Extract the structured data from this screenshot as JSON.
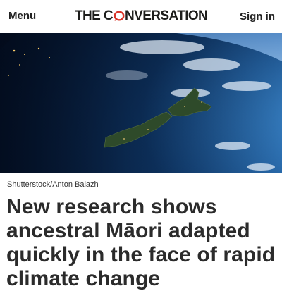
{
  "header": {
    "menu_label": "Menu",
    "logo_prefix": "THE C",
    "logo_suffix": "NVERSATION",
    "logo_icon": "speech-bubble-icon",
    "signin_label": "Sign in",
    "accent_color": "#d8352a"
  },
  "hero": {
    "image_subject": "earth-from-space-new-zealand",
    "caption": "Shutterstock/Anton Balazh"
  },
  "article": {
    "headline": "New research shows ancestral Māori adapted quickly in the face of rapid climate change"
  }
}
